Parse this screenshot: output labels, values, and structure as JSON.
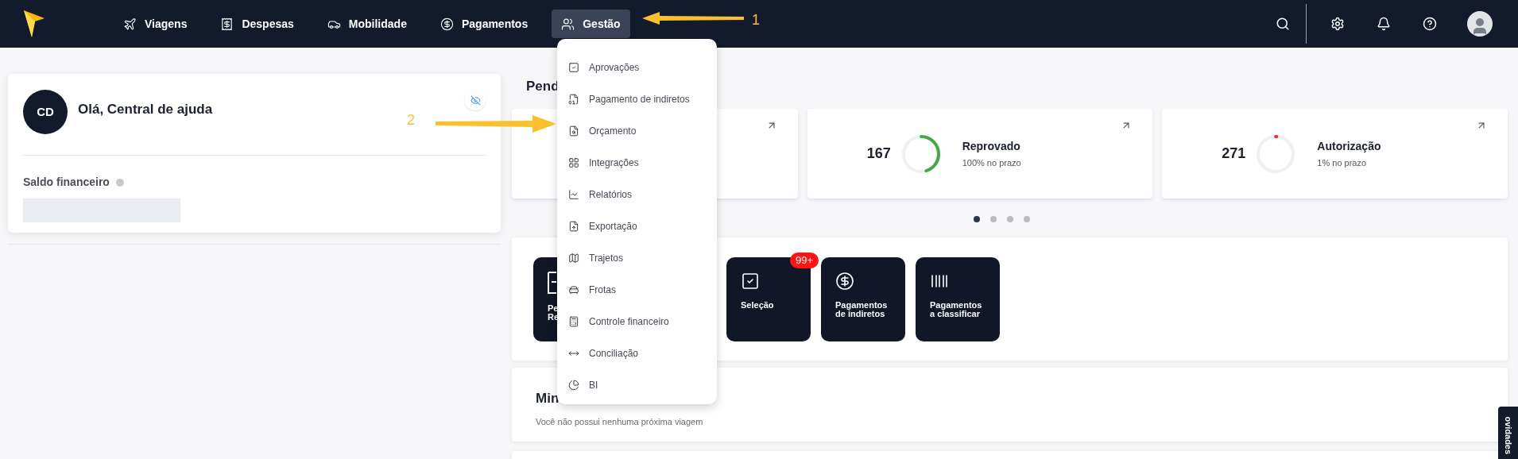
{
  "nav": {
    "items": [
      {
        "label": "Viagens",
        "selected": false
      },
      {
        "label": "Despesas",
        "selected": false
      },
      {
        "label": "Mobilidade",
        "selected": false
      },
      {
        "label": "Pagamentos",
        "selected": false
      },
      {
        "label": "Gestão",
        "selected": true
      }
    ]
  },
  "annotations": [
    {
      "label": "1"
    },
    {
      "label": "2"
    }
  ],
  "profile": {
    "initials": "CD",
    "greeting": "Olá, Central de ajuda",
    "balance_label": "Saldo financeiro"
  },
  "menu": {
    "items": [
      {
        "label": "Aprovações"
      },
      {
        "label": "Pagamento de indiretos"
      },
      {
        "label": "Orçamento"
      },
      {
        "label": "Integrações"
      },
      {
        "label": "Relatórios"
      },
      {
        "label": "Exportação"
      },
      {
        "label": "Trajetos"
      },
      {
        "label": "Frotas"
      },
      {
        "label": "Controle financeiro"
      },
      {
        "label": "Conciliação"
      },
      {
        "label": "BI"
      }
    ]
  },
  "pending": {
    "heading": "Pend",
    "cards": [
      {
        "value": "167",
        "title": "Reprovado",
        "subtitle": "100% no prazo",
        "level": 0.45,
        "color": "#43a947"
      },
      {
        "value": "271",
        "title": "Autorização",
        "subtitle": "1% no prazo",
        "level": 0.01,
        "color": "#e53935"
      }
    ],
    "dots": [
      {
        "selected": true
      },
      {
        "selected": false
      },
      {
        "selected": false
      },
      {
        "selected": false
      }
    ]
  },
  "shortcuts": [
    {
      "lines": [
        "Pe",
        "Re"
      ]
    },
    {
      "lines": [
        "Seleção"
      ],
      "badge": "99+"
    },
    {
      "lines": [
        "Pagamentos",
        "de indiretos"
      ]
    },
    {
      "lines": [
        "Pagamentos",
        "a classificar"
      ]
    }
  ],
  "trips": {
    "heading": "Min",
    "message": "Você não possui nenhuma próxima viagem"
  },
  "side_tab": {
    "label": "ovidades"
  }
}
